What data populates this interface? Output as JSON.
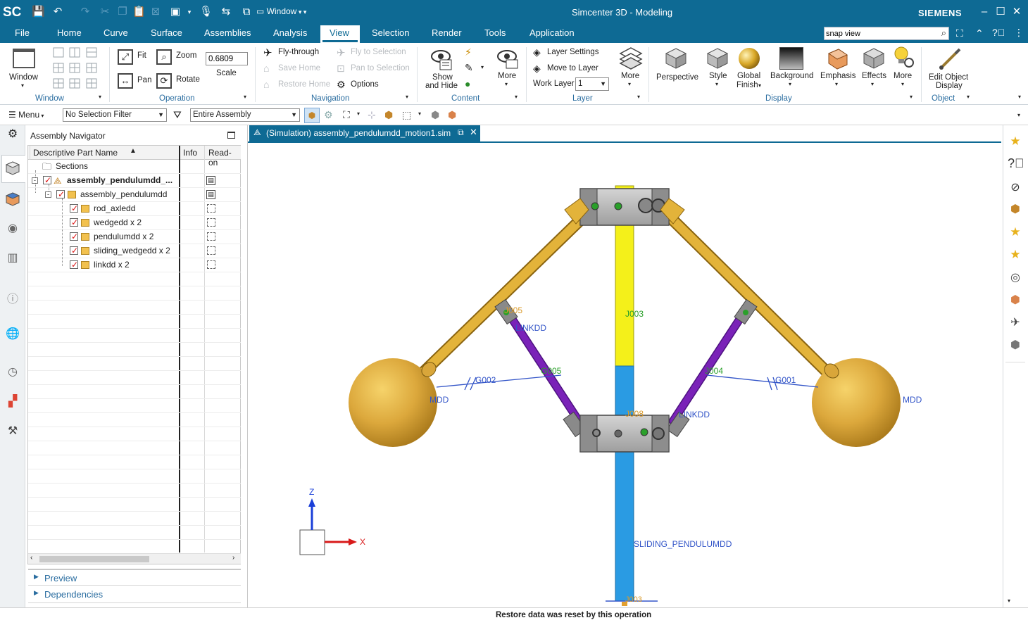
{
  "app": {
    "logo": "SC",
    "title": "Simcenter 3D - Modeling",
    "brand": "SIEMENS",
    "window_menu": "Window"
  },
  "menu": {
    "items": [
      "File",
      "Home",
      "Curve",
      "Surface",
      "Assemblies",
      "Analysis",
      "View",
      "Selection",
      "Render",
      "Tools",
      "Application"
    ],
    "active": "View"
  },
  "search": {
    "value": "snap view"
  },
  "ribbon": {
    "window_group": {
      "label": "Window",
      "window_button": "Window"
    },
    "operation_group": {
      "label": "Operation",
      "fit": "Fit",
      "zoom": "Zoom",
      "pan": "Pan",
      "rotate": "Rotate",
      "scale_value": "0.6809",
      "scale_label": "Scale"
    },
    "navigation_group": {
      "label": "Navigation",
      "fly_through": "Fly-through",
      "save_home": "Save Home",
      "restore_home": "Restore Home",
      "fly_to_selection": "Fly to Selection",
      "pan_to_selection": "Pan to Selection",
      "options": "Options"
    },
    "content_group": {
      "label": "Content",
      "show_and_hide_1": "Show",
      "show_and_hide_2": "and Hide",
      "more": "More"
    },
    "layer_group": {
      "label": "Layer",
      "layer_settings": "Layer Settings",
      "move_to_layer": "Move to Layer",
      "work_layer": "Work Layer",
      "work_layer_value": "1",
      "more": "More"
    },
    "display_group": {
      "label": "Display",
      "perspective": "Perspective",
      "style": "Style",
      "global_finish_1": "Global",
      "global_finish_2": "Finish",
      "background": "Background",
      "emphasis": "Emphasis",
      "effects": "Effects",
      "more": "More"
    },
    "object_group": {
      "label": "Object",
      "edit_object_display_1": "Edit Object",
      "edit_object_display_2": "Display"
    }
  },
  "selbar": {
    "menu": "Menu",
    "filter": "No Selection Filter",
    "scope": "Entire Assembly"
  },
  "navigator": {
    "title": "Assembly Navigator",
    "columns": [
      "Descriptive Part Name",
      "Info",
      "Read-on"
    ],
    "rows": [
      {
        "name": "Sections"
      },
      {
        "name": "assembly_pendulumdd_..."
      },
      {
        "name": "assembly_pendulumdd"
      },
      {
        "name": "rod_axledd"
      },
      {
        "name": "wedgedd x 2"
      },
      {
        "name": "pendulumdd x 2"
      },
      {
        "name": "sliding_wedgedd x 2"
      },
      {
        "name": "linkdd x 2"
      }
    ],
    "preview": "Preview",
    "dependencies": "Dependencies"
  },
  "viewport": {
    "tab": "(Simulation) assembly_pendulumdd_motion1.sim",
    "labels": {
      "j005": "J005",
      "linkdd_l": "LINKDD",
      "j003": "J003",
      "g002": "G002",
      "mdd_l": "MDD",
      "g005": "G005",
      "j004": "J004",
      "g001": "G001",
      "mdd_r": "MDD",
      "j008": "J008",
      "linkdd_r": "LINKDD",
      "overlap": "SLIDING_PENDULUMDD",
      "j003b": "J003",
      "axis_z": "Z",
      "axis_x": "X"
    },
    "colors": {
      "gold": "#e3b33a",
      "purple": "#7a22b8",
      "yellow": "#f4f01a",
      "blue": "#2a9be3",
      "gray": "#b7b7b7",
      "label_blue": "#3355c8",
      "label_green": "#2aa02a"
    }
  },
  "status": {
    "message": "Restore data was reset by this operation"
  }
}
